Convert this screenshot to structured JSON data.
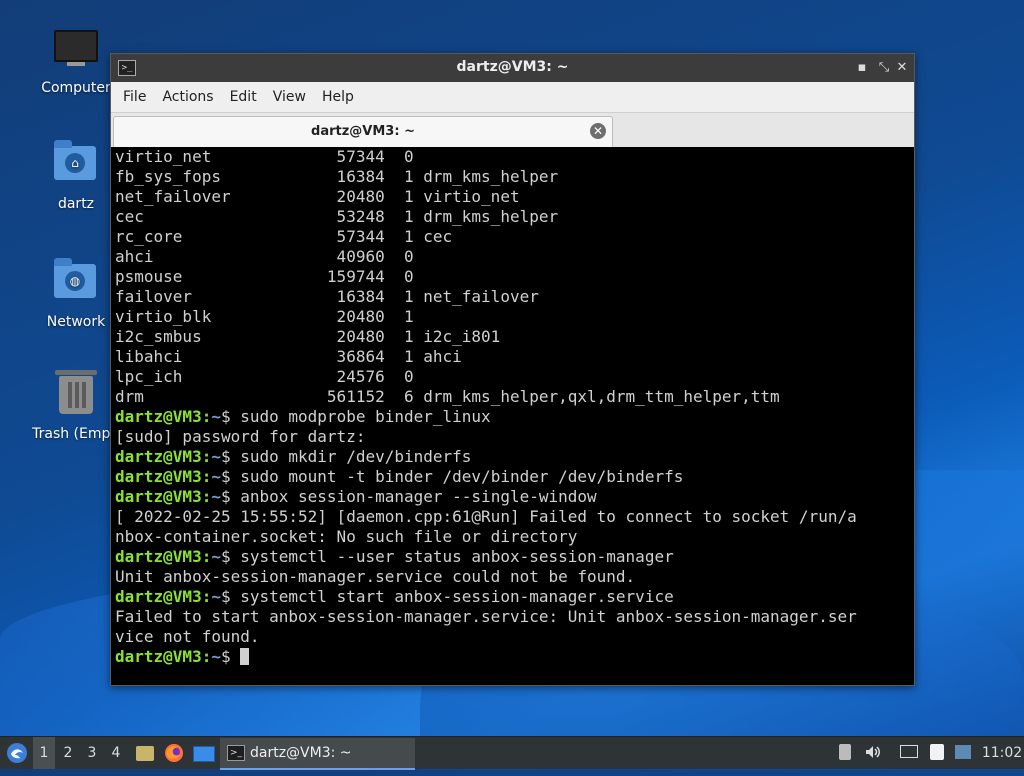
{
  "desktop": {
    "icons": [
      {
        "label": "Computer",
        "icon": "computer-icon"
      },
      {
        "label": "dartz",
        "icon": "home-folder-icon"
      },
      {
        "label": "Network",
        "icon": "network-folder-icon"
      },
      {
        "label": "Trash (Empt",
        "icon": "trash-icon"
      }
    ]
  },
  "window": {
    "title": "dartz@VM3: ~",
    "controls": {
      "minimize": "▪",
      "maximize": "⤡",
      "close": "✕"
    },
    "menu": [
      "File",
      "Actions",
      "Edit",
      "View",
      "Help"
    ],
    "tab": {
      "title": "dartz@VM3: ~",
      "close": "✕"
    }
  },
  "terminal": {
    "prompt_user": "dartz@VM3",
    "prompt_path": "~",
    "lines": [
      {
        "type": "out",
        "text": "virtio_net             57344  0"
      },
      {
        "type": "out",
        "text": "fb_sys_fops            16384  1 drm_kms_helper"
      },
      {
        "type": "out",
        "text": "net_failover           20480  1 virtio_net"
      },
      {
        "type": "out",
        "text": "cec                    53248  1 drm_kms_helper"
      },
      {
        "type": "out",
        "text": "rc_core                57344  1 cec"
      },
      {
        "type": "out",
        "text": "ahci                   40960  0"
      },
      {
        "type": "out",
        "text": "psmouse               159744  0"
      },
      {
        "type": "out",
        "text": "failover               16384  1 net_failover"
      },
      {
        "type": "out",
        "text": "virtio_blk             20480  1"
      },
      {
        "type": "out",
        "text": "i2c_smbus              20480  1 i2c_i801"
      },
      {
        "type": "out",
        "text": "libahci                36864  1 ahci"
      },
      {
        "type": "out",
        "text": "lpc_ich                24576  0"
      },
      {
        "type": "out",
        "text": "drm                   561152  6 drm_kms_helper,qxl,drm_ttm_helper,ttm"
      },
      {
        "type": "cmd",
        "text": "sudo modprobe binder_linux"
      },
      {
        "type": "out",
        "text": "[sudo] password for dartz:"
      },
      {
        "type": "cmd",
        "text": "sudo mkdir /dev/binderfs"
      },
      {
        "type": "cmd",
        "text": "sudo mount -t binder /dev/binder /dev/binderfs"
      },
      {
        "type": "cmd",
        "text": "anbox session-manager --single-window"
      },
      {
        "type": "out",
        "text": "[ 2022-02-25 15:55:52] [daemon.cpp:61@Run] Failed to connect to socket /run/a"
      },
      {
        "type": "out",
        "text": "nbox-container.socket: No such file or directory"
      },
      {
        "type": "cmd",
        "text": "systemctl --user status anbox-session-manager"
      },
      {
        "type": "out",
        "text": "Unit anbox-session-manager.service could not be found."
      },
      {
        "type": "cmd",
        "text": "systemctl start anbox-session-manager.service"
      },
      {
        "type": "out",
        "text": "Failed to start anbox-session-manager.service: Unit anbox-session-manager.ser"
      },
      {
        "type": "out",
        "text": "vice not found."
      },
      {
        "type": "cmd",
        "text": "",
        "cursor": true
      }
    ]
  },
  "taskbar": {
    "workspaces": [
      "1",
      "2",
      "3",
      "4"
    ],
    "active_workspace": "1",
    "task": {
      "label": "dartz@VM3: ~"
    },
    "clock": "11:02",
    "colors": {
      "accent": "#6d9ee8",
      "prompt": "#8ae234",
      "path": "#729fcf"
    }
  }
}
